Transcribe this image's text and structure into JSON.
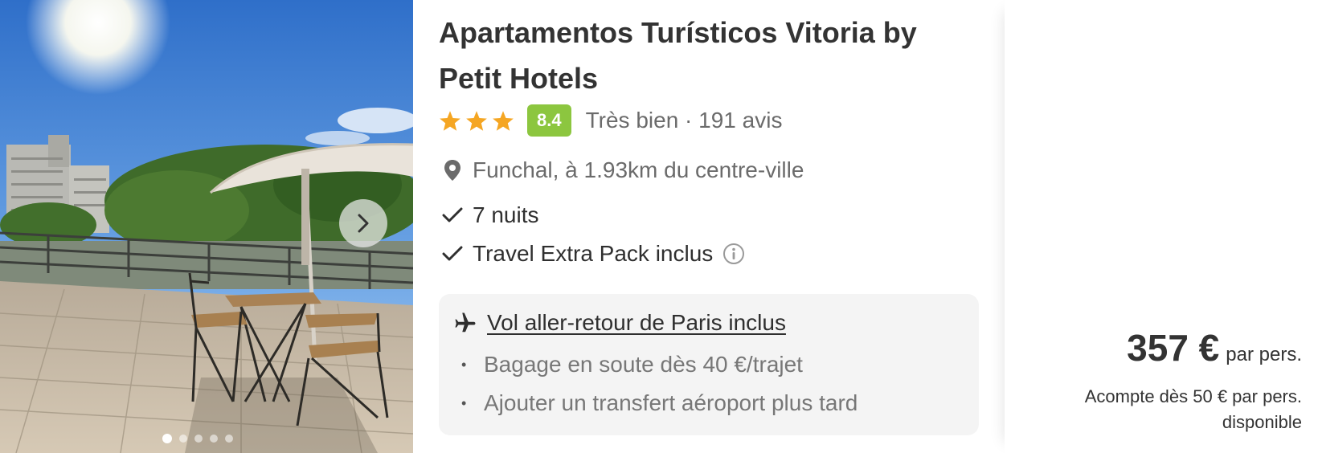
{
  "hotel": {
    "name": "Apartamentos Turísticos Vitoria by Petit Hotels",
    "stars": 3,
    "score": "8.4",
    "rating_label": "Très bien · 191 avis",
    "location": "Funchal, à 1.93km du centre-ville"
  },
  "features": {
    "nights": "7 nuits",
    "travel_pack": "Travel Extra Pack inclus"
  },
  "flight": {
    "title": "Vol aller-retour de Paris inclus",
    "baggage": "Bagage en soute dès 40 €/trajet",
    "transfer": "Ajouter un transfert aéroport plus tard"
  },
  "price": {
    "amount": "357 €",
    "per": "par pers.",
    "deposit": "Acompte dès 50 € par pers. disponible"
  },
  "carousel": {
    "slides": 5,
    "active_index": 0
  },
  "colors": {
    "score_badge": "#8cc63f",
    "star": "#f5a623"
  },
  "icons": [
    "star-icon",
    "location-pin-icon",
    "check-icon",
    "info-icon",
    "plane-icon",
    "chevron-right-icon"
  ]
}
